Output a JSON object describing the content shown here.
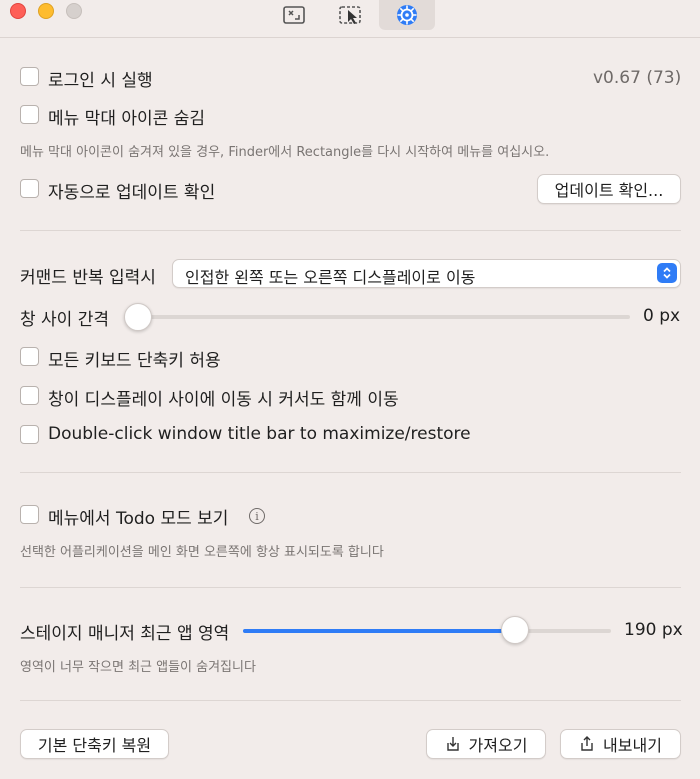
{
  "window": {
    "tabs": [
      {
        "icon": "window-snap-icon"
      },
      {
        "icon": "cursor-select-icon"
      },
      {
        "icon": "gear-settings-icon",
        "active": true
      }
    ]
  },
  "general": {
    "launch_on_login": {
      "label": "로그인 시 실행",
      "checked": false
    },
    "version": "v0.67 (73)",
    "hide_menu_icon": {
      "label": "메뉴 막대 아이콘 숨김",
      "checked": false
    },
    "hide_menu_hint": "메뉴 막대 아이콘이 숨겨져 있을 경우, Finder에서 Rectangle를 다시 시작하여 메뉴를 여십시오.",
    "auto_update": {
      "label": "자동으로 업데이트 확인",
      "checked": false
    },
    "check_update_button": "업데이트 확인..."
  },
  "behavior": {
    "repeat_command_label": "커맨드 반복 입력시",
    "repeat_command_value": "인접한 왼쪽 또는 오른쪽 디스플레이로 이동",
    "gap_label": "창 사이 간격",
    "gap_value": "0 px",
    "gap_fraction": 0.0,
    "allow_all_shortcuts": {
      "label": "모든 키보드 단축키 허용",
      "checked": false
    },
    "move_cursor": {
      "label": "창이 디스플레이 사이에 이동 시 커서도 함께 이동",
      "checked": false
    },
    "double_click": {
      "label": "Double-click window title bar to maximize/restore",
      "checked": false
    }
  },
  "todo": {
    "todo_mode": {
      "label": "메뉴에서 Todo 모드 보기",
      "checked": false
    },
    "info_icon": "info-icon",
    "todo_hint": "선택한 어플리케이션을 메인 화면 오른쪽에 항상 표시되도록 합니다"
  },
  "stage": {
    "label": "스테이지 매니저 최근 앱 영역",
    "value": "190 px",
    "fraction": 0.74,
    "hint": "영역이 너무 작으면 최근 앱들이 숨겨집니다"
  },
  "footer": {
    "restore_button": "기본 단축키 복원",
    "import_button": "가져오기",
    "export_button": "내보내기"
  },
  "colors": {
    "accent": "#2f7cf6",
    "background": "#f2ecea"
  }
}
